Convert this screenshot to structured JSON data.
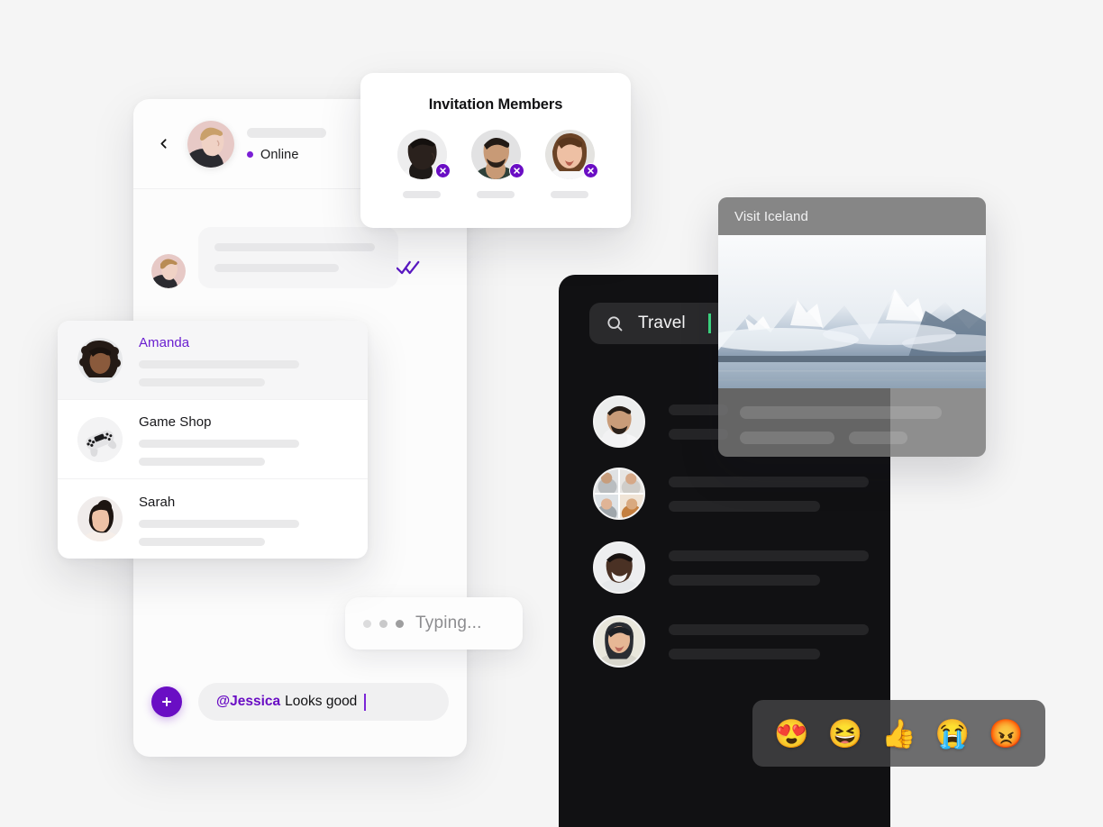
{
  "page": {
    "background_color": "#f5f5f5",
    "accent_purple": "#6a0ec4",
    "accent_green": "#3ddc84",
    "dark_panel_color": "#111113"
  },
  "chat": {
    "back_icon": "chevron-left-icon",
    "avatar": "user-avatar-blond-man",
    "status_text": "Online",
    "status_dot_color": "#7b1fd6",
    "message": {
      "sender_avatar": "user-avatar-blond-man",
      "read_receipt_icon": "double-check-icon",
      "read_receipt_color": "#5b19c4"
    },
    "typing": {
      "label": "Typing...",
      "dot_count": 3
    },
    "composer": {
      "add_icon": "plus-icon",
      "mention": "@Jessica",
      "text": "Looks good",
      "caret_color": "#7b25d6"
    }
  },
  "invitation": {
    "title": "Invitation Members",
    "members": [
      {
        "avatar": "member-avatar-1",
        "remove_icon": "close-icon"
      },
      {
        "avatar": "member-avatar-2",
        "remove_icon": "close-icon"
      },
      {
        "avatar": "member-avatar-3",
        "remove_icon": "close-icon"
      }
    ]
  },
  "contacts": [
    {
      "name": "Amanda",
      "avatar": "contact-avatar-amanda",
      "active": true
    },
    {
      "name": "Game Shop",
      "avatar": "contact-avatar-game-shop",
      "active": false
    },
    {
      "name": "Sarah",
      "avatar": "contact-avatar-sarah",
      "active": false
    }
  ],
  "dark_panel": {
    "search": {
      "icon": "search-icon",
      "value": "Travel",
      "caret_color": "#3ddc84"
    },
    "rows": [
      {
        "avatar": "dark-avatar-1",
        "type": "single"
      },
      {
        "avatar": "dark-avatar-2",
        "type": "group"
      },
      {
        "avatar": "dark-avatar-3",
        "type": "single"
      },
      {
        "avatar": "dark-avatar-4",
        "type": "single"
      }
    ]
  },
  "iceland_card": {
    "title": "Visit Iceland",
    "photo": "iceland-mountains-photo"
  },
  "emoji_bar": {
    "emojis": [
      {
        "name": "heart-eyes-emoji",
        "glyph": "😍"
      },
      {
        "name": "grinning-squinting-emoji",
        "glyph": "😆"
      },
      {
        "name": "thumbs-up-emoji",
        "glyph": "👍"
      },
      {
        "name": "loudly-crying-emoji",
        "glyph": "😭"
      },
      {
        "name": "angry-face-emoji",
        "glyph": "😡"
      }
    ]
  }
}
